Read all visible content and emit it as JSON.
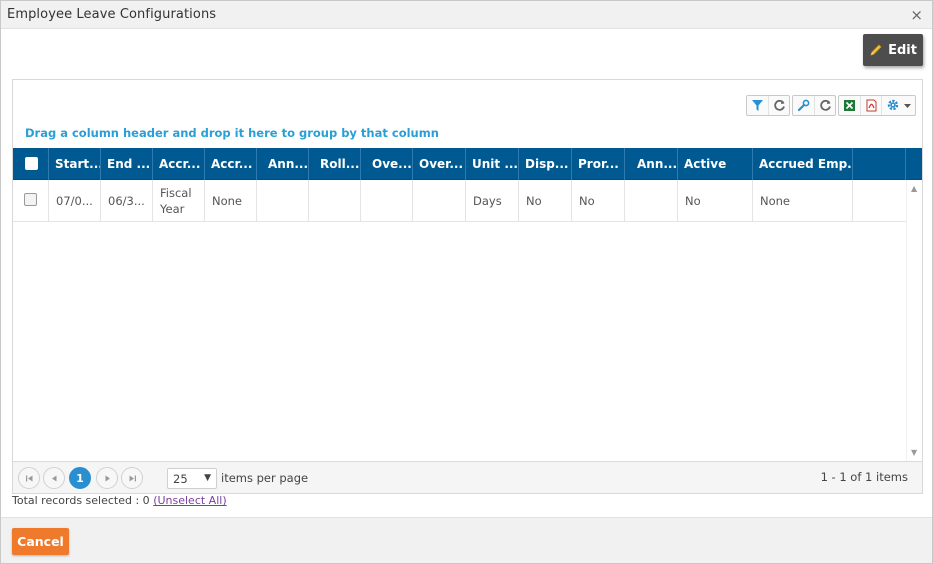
{
  "dialog": {
    "title": "Employee Leave Configurations",
    "close_label": "×"
  },
  "actions": {
    "edit_label": "Edit",
    "cancel_label": "Cancel"
  },
  "toolbar": {
    "icons": [
      "filter-icon",
      "refresh-icon",
      "wrench-icon",
      "refresh-icon",
      "excel-icon",
      "pdf-icon",
      "gear-icon",
      "chevron-down-icon"
    ]
  },
  "grid": {
    "group_hint": "Drag a column header and drop it here to group by that column",
    "columns": [
      "Start...",
      "End ...",
      "Accr...",
      "Accr...",
      "Ann...",
      "Roll...",
      "Ove...",
      "Over...",
      "Unit ...",
      "Disp...",
      "Pror...",
      "Ann...",
      "Active",
      "Accrued Emp..."
    ],
    "rows": [
      [
        "07/0...",
        "06/3...",
        "Fiscal Year",
        "None",
        "",
        "",
        "",
        "",
        "Days",
        "No",
        "No",
        "",
        "No",
        "None"
      ]
    ]
  },
  "pager": {
    "current_page": "1",
    "page_size": "25",
    "page_size_label": "items per page",
    "info": "1 - 1 of 1 items"
  },
  "selection": {
    "label": "Total records selected : 0",
    "unselect_label": "(Unselect All)"
  },
  "colors": {
    "header_bg": "#005a91",
    "group_hint": "#2a9fd6",
    "edit_bg": "#4d4d4d",
    "cancel_bg": "#f07a2c",
    "active_page": "#2a8fd0"
  }
}
